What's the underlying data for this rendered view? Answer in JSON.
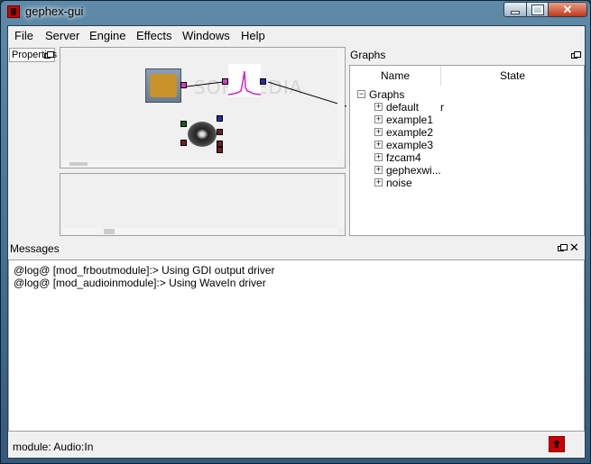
{
  "window": {
    "title": "gephex-gui"
  },
  "menu": [
    "File",
    "Server",
    "Engine",
    "Effects",
    "Windows",
    "Help"
  ],
  "properties": {
    "label": "Properties"
  },
  "canvas": {
    "watermark": "SOFTPEDIA"
  },
  "graphs": {
    "title": "Graphs",
    "columns": [
      "Name",
      "State"
    ],
    "root": "Graphs",
    "items": [
      {
        "name": "default",
        "state": "r"
      },
      {
        "name": "example1",
        "state": ""
      },
      {
        "name": "example2",
        "state": ""
      },
      {
        "name": "example3",
        "state": ""
      },
      {
        "name": "fzcam4",
        "state": ""
      },
      {
        "name": "gephexwi...",
        "state": ""
      },
      {
        "name": "noise",
        "state": ""
      }
    ]
  },
  "messages": {
    "title": "Messages",
    "lines": [
      "@log@ [mod_frboutmodule]:> Using GDI output driver",
      "@log@ [mod_audioinmodule]:> Using WaveIn driver"
    ]
  },
  "status": {
    "text": "module: Audio:In"
  },
  "colors": {
    "port_pink": "#d040c0",
    "port_blue": "#2030a0",
    "port_green": "#106020",
    "port_red": "#702020"
  }
}
